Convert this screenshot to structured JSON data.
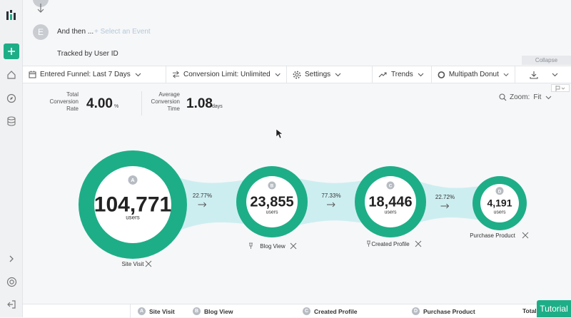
{
  "sidebar": {
    "logo_icon": "logo-icon",
    "items": [
      {
        "name": "add-icon"
      },
      {
        "name": "home-icon"
      },
      {
        "name": "compass-icon"
      },
      {
        "name": "database-icon"
      },
      {
        "name": "expand-icon"
      },
      {
        "name": "help-icon"
      },
      {
        "name": "logout-icon"
      }
    ]
  },
  "builder": {
    "step_badge": "E",
    "and_then": "And then ...",
    "select_event": "+ Select an Event",
    "tracked_by": "Tracked by User ID",
    "collapse": "Collapse"
  },
  "toolbar": {
    "entered_funnel": "Entered Funnel: Last 7 Days",
    "conversion_limit": "Conversion Limit: Unlimited",
    "settings": "Settings",
    "trends": "Trends",
    "multipath": "Multipath Donut"
  },
  "stats": {
    "total_label_1": "Total",
    "total_label_2": "Conversion",
    "total_label_3": "Rate",
    "total_value": "4.00",
    "total_unit": "%",
    "avg_label_1": "Average",
    "avg_label_2": "Conversion",
    "avg_label_3": "Time",
    "avg_value": "1.08",
    "avg_unit": "days",
    "zoom_label": "Zoom:",
    "zoom_value": "Fit"
  },
  "funnel": {
    "accent": "#1eae87",
    "flow_color": "#cdeef0",
    "unit": "users",
    "steps": [
      {
        "letter": "A",
        "value": "104,771",
        "name": "Site Visit"
      },
      {
        "letter": "B",
        "value": "23,855",
        "name": "Blog View"
      },
      {
        "letter": "C",
        "value": "18,446",
        "name": "Created Profile"
      },
      {
        "letter": "D",
        "value": "4,191",
        "name": "Purchase Product"
      }
    ],
    "conversions": [
      "22.77%",
      "77.33%",
      "22.72%"
    ]
  },
  "footer": {
    "columns": [
      {
        "letter": "A",
        "name": "Site Visit"
      },
      {
        "letter": "B",
        "name": "Blog View"
      },
      {
        "letter": "C",
        "name": "Created Profile"
      },
      {
        "letter": "D",
        "name": "Purchase Product"
      }
    ],
    "total": "Total"
  },
  "tutorial": "Tutorial"
}
